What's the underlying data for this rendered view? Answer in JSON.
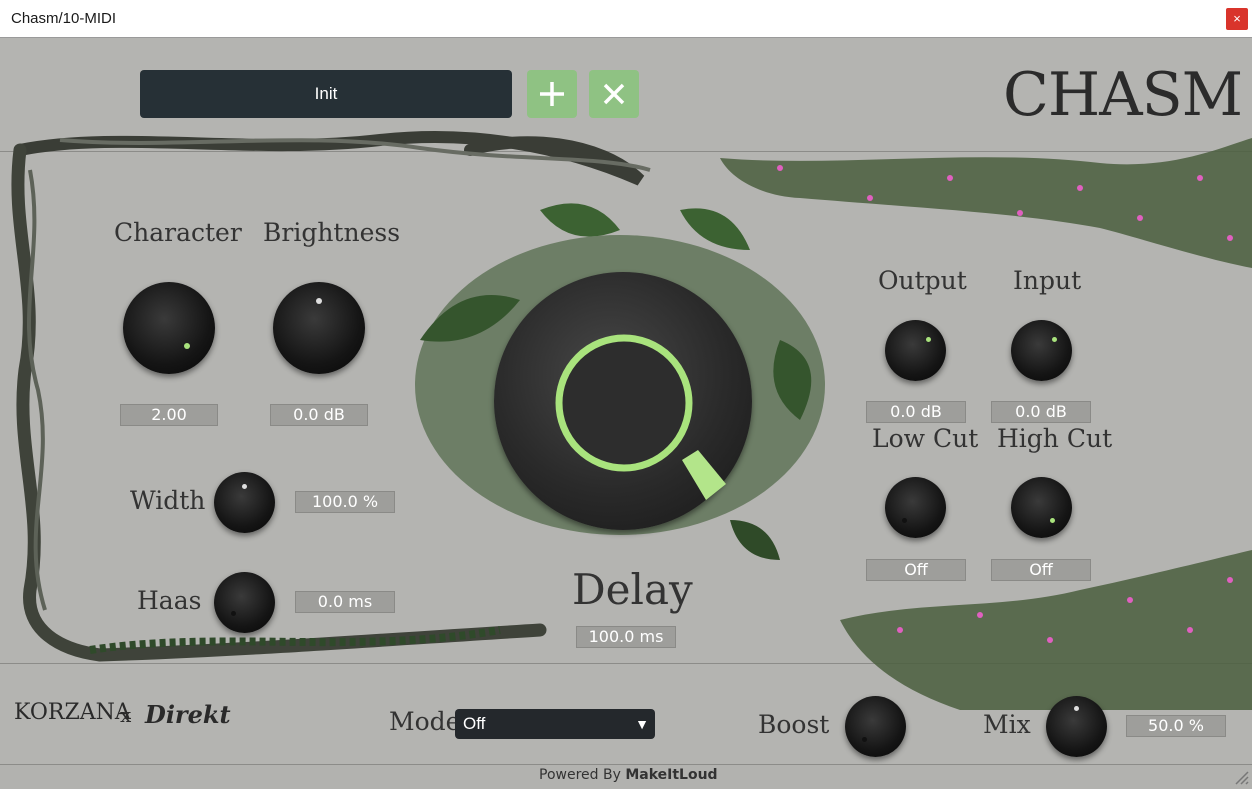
{
  "window": {
    "title": "Chasm/10-MIDI",
    "close_symbol": "×"
  },
  "preset": {
    "name": "Init",
    "add_symbol": "+",
    "delete_symbol": "✕"
  },
  "brand": {
    "logo": "CHASM",
    "partner1": "KORZANA",
    "x": "x",
    "partner2": "Direkt"
  },
  "left": {
    "character": {
      "label": "Character",
      "value": "2.00"
    },
    "brightness": {
      "label": "Brightness",
      "value": "0.0 dB"
    },
    "width": {
      "label": "Width",
      "value": "100.0 %"
    },
    "haas": {
      "label": "Haas",
      "value": "0.0 ms"
    }
  },
  "center": {
    "delay": {
      "label": "Delay",
      "value": "100.0 ms"
    }
  },
  "right": {
    "output": {
      "label": "Output",
      "value": "0.0 dB"
    },
    "input": {
      "label": "Input",
      "value": "0.0 dB"
    },
    "lowcut": {
      "label": "Low Cut",
      "value": "Off"
    },
    "highcut": {
      "label": "High Cut",
      "value": "Off"
    }
  },
  "bottom": {
    "mode": {
      "label": "Mode",
      "selected": "Off"
    },
    "boost": {
      "label": "Boost"
    },
    "mix": {
      "label": "Mix",
      "value": "50.0 %"
    }
  },
  "footer": {
    "powered_by": "Powered By",
    "powered_brand": "MakeItLoud"
  },
  "colors": {
    "accent": "#a9e37d",
    "preset_bg": "#263036",
    "button_green": "#8fc283",
    "panel": "#b4b4b1"
  }
}
